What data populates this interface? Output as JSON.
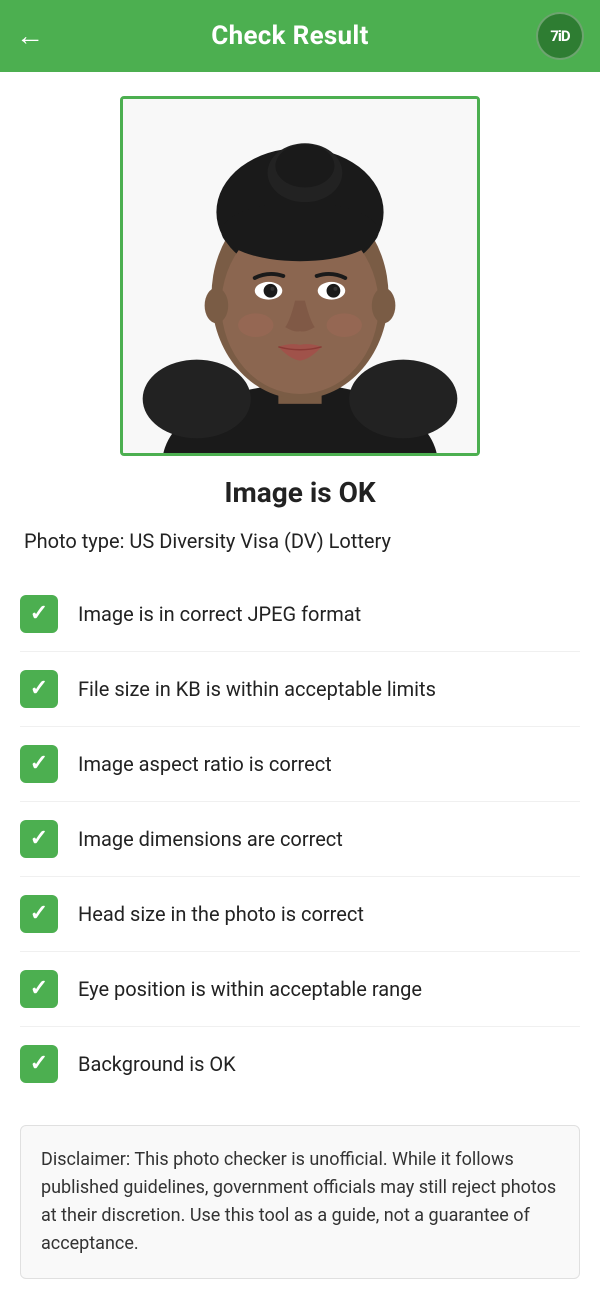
{
  "header": {
    "back_icon": "←",
    "title": "Check Result",
    "logo_text": "7iD"
  },
  "photo": {
    "alt": "Passport photo of a woman"
  },
  "status": {
    "text": "Image is OK"
  },
  "photo_type": {
    "label": "Photo type: US Diversity Visa (DV) Lottery"
  },
  "checks": [
    {
      "label": "Image is in correct JPEG format"
    },
    {
      "label": "File size in KB is within acceptable limits"
    },
    {
      "label": "Image aspect ratio is correct"
    },
    {
      "label": "Image dimensions are correct"
    },
    {
      "label": "Head size in the photo is correct"
    },
    {
      "label": "Eye position is within acceptable range"
    },
    {
      "label": "Background is OK"
    }
  ],
  "disclaimer": {
    "text": "Disclaimer: This photo checker is unofficial. While it follows published guidelines, government officials may still reject photos at their discretion. Use this tool as a guide, not a guarantee of acceptance."
  }
}
